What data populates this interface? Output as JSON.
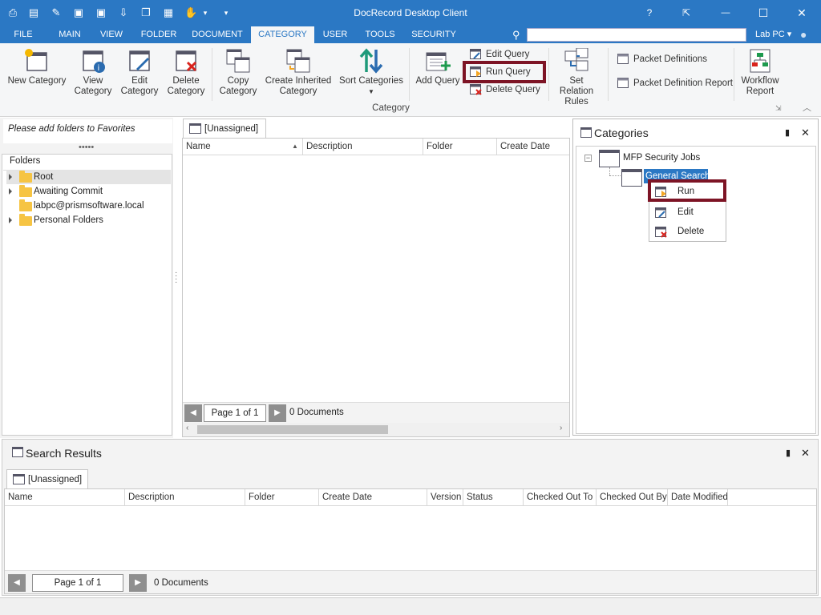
{
  "app": {
    "title": "DocRecord Desktop Client"
  },
  "window": {
    "help": "?",
    "restore": "⇱",
    "minimize": "—",
    "maximize": "☐",
    "close": "✕"
  },
  "menu": {
    "tabs": [
      "FILE",
      "MAIN",
      "VIEW",
      "FOLDER",
      "DOCUMENT",
      "CATEGORY",
      "USER",
      "TOOLS",
      "SECURITY"
    ],
    "active": "CATEGORY",
    "search_placeholder": "",
    "user": "Lab PC"
  },
  "ribbon": {
    "new_category": "New Category",
    "view_category": [
      "View",
      "Category"
    ],
    "edit_category": [
      "Edit",
      "Category"
    ],
    "delete_category": [
      "Delete",
      "Category"
    ],
    "copy_category": [
      "Copy",
      "Category"
    ],
    "create_inherited": [
      "Create Inherited",
      "Category"
    ],
    "sort_categories": "Sort Categories",
    "add_query": "Add Query",
    "edit_query": "Edit Query",
    "run_query": "Run Query",
    "delete_query": "Delete Query",
    "set_relation": [
      "Set Relation",
      "Rules"
    ],
    "packet_definitions": "Packet Definitions",
    "packet_definition_report": "Packet Definition Report",
    "workflow_report": [
      "Workflow",
      "Report"
    ],
    "group_label": "Category"
  },
  "left": {
    "favorites": "Please add folders to Favorites",
    "folders_label": "Folders",
    "items": [
      {
        "label": "Root",
        "expandable": true,
        "selected": true
      },
      {
        "label": "Awaiting Commit",
        "expandable": true,
        "selected": false
      },
      {
        "label": "labpc@prismsoftware.local",
        "expandable": false,
        "selected": false
      },
      {
        "label": "Personal Folders",
        "expandable": true,
        "selected": false
      }
    ]
  },
  "center": {
    "tab": "[Unassigned]",
    "columns": [
      "Name",
      "Description",
      "Folder",
      "Create Date"
    ],
    "page": "Page 1 of 1",
    "count": "0 Documents"
  },
  "categories": {
    "title": "Categories",
    "root": "MFP Security Jobs",
    "child": "General Search",
    "context_menu": [
      "Run",
      "Edit",
      "Delete"
    ]
  },
  "search_results": {
    "title": "Search Results",
    "tab": "[Unassigned]",
    "columns": [
      "Name",
      "Description",
      "Folder",
      "Create Date",
      "Version",
      "Status",
      "Checked Out To",
      "Checked Out By",
      "Date Modified"
    ],
    "page": "Page 1 of 1",
    "count": "0 Documents"
  },
  "colors": {
    "accent": "#2b78c4",
    "highlight": "#7d1425"
  }
}
